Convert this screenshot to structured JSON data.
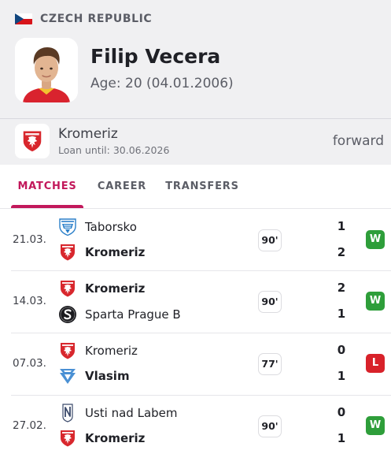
{
  "header": {
    "country": "CZECH REPUBLIC",
    "player_name": "Filip Vecera",
    "age_text": "Age: 20 (04.01.2006)"
  },
  "club": {
    "name": "Kromeriz",
    "loan_text": "Loan until: 30.06.2026",
    "position": "forward",
    "logo_icon": "kromeriz-crest-icon"
  },
  "tabs": [
    {
      "label": "MATCHES",
      "active": true
    },
    {
      "label": "CAREER",
      "active": false
    },
    {
      "label": "TRANSFERS",
      "active": false
    }
  ],
  "colors": {
    "accent": "#c2185b",
    "win": "#2e9e3a",
    "loss": "#d8222a",
    "kromeriz_red": "#d8272d",
    "flag_blue": "#11457e",
    "flag_red": "#d7141a"
  },
  "matches": [
    {
      "date": "21.03.",
      "home": {
        "name": "Taborsko",
        "icon": "taborsko-crest-icon"
      },
      "away": {
        "name": "Kromeriz",
        "icon": "kromeriz-crest-icon"
      },
      "minutes": "90'",
      "home_score": "1",
      "away_score": "2",
      "result": "W"
    },
    {
      "date": "14.03.",
      "home": {
        "name": "Kromeriz",
        "icon": "kromeriz-crest-icon"
      },
      "away": {
        "name": "Sparta Prague B",
        "icon": "sparta-crest-icon"
      },
      "minutes": "90'",
      "home_score": "2",
      "away_score": "1",
      "result": "W"
    },
    {
      "date": "07.03.",
      "home": {
        "name": "Kromeriz",
        "icon": "kromeriz-crest-icon"
      },
      "away": {
        "name": "Vlasim",
        "icon": "vlasim-crest-icon"
      },
      "minutes": "77'",
      "home_score": "0",
      "away_score": "1",
      "result": "L"
    },
    {
      "date": "27.02.",
      "home": {
        "name": "Usti nad Labem",
        "icon": "usti-crest-icon"
      },
      "away": {
        "name": "Kromeriz",
        "icon": "kromeriz-crest-icon"
      },
      "minutes": "90'",
      "home_score": "0",
      "away_score": "1",
      "result": "W"
    }
  ]
}
